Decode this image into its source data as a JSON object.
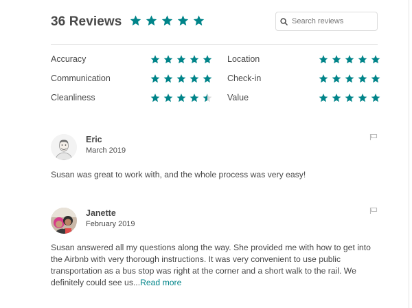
{
  "header": {
    "title": "36 Reviews",
    "overall_rating": 5,
    "search_placeholder": "Search reviews",
    "search_value": ""
  },
  "categories": [
    {
      "label": "Accuracy",
      "rating": 5
    },
    {
      "label": "Communication",
      "rating": 5
    },
    {
      "label": "Cleanliness",
      "rating": 4.5
    },
    {
      "label": "Location",
      "rating": 5
    },
    {
      "label": "Check-in",
      "rating": 5
    },
    {
      "label": "Value",
      "rating": 5
    }
  ],
  "reviews": [
    {
      "name": "Eric",
      "date": "March 2019",
      "text": "Susan was great to work with, and the whole process was very easy!"
    },
    {
      "name": "Janette",
      "date": "February 2019",
      "text": "Susan answered all my questions along the way. She provided me with how to get into the Airbnb with very thorough instructions. It was very convenient to use public transportation as a bus stop was right at the corner and a short walk to the rail. We definitely could see us...",
      "read_more": "Read more"
    }
  ],
  "colors": {
    "star": "#008489",
    "star_empty": "#d8d8d8",
    "text": "#484848",
    "link": "#008489",
    "divider": "#e4e4e4"
  },
  "icons": {
    "search": "search-icon",
    "flag": "flag-icon",
    "star": "star-icon"
  }
}
